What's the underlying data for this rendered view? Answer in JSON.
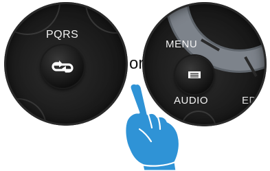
{
  "left_remote": {
    "button_label": "PQRS",
    "button_icon": "repeat-arrows-icon"
  },
  "separator": "or",
  "right_remote": {
    "menu_label": "MENU",
    "menu_icon": "menu-list-icon",
    "audio_label": "AUDIO",
    "partial_label": "ED"
  },
  "hand_icon": "pointing-hand-icon",
  "colors": {
    "hand_blue": "#2f93d6",
    "hand_outline": "#ffffff",
    "remote_body": "#1a1a1a",
    "label_text": "#f2f2f2",
    "wheel_gray": "#7a8088"
  }
}
